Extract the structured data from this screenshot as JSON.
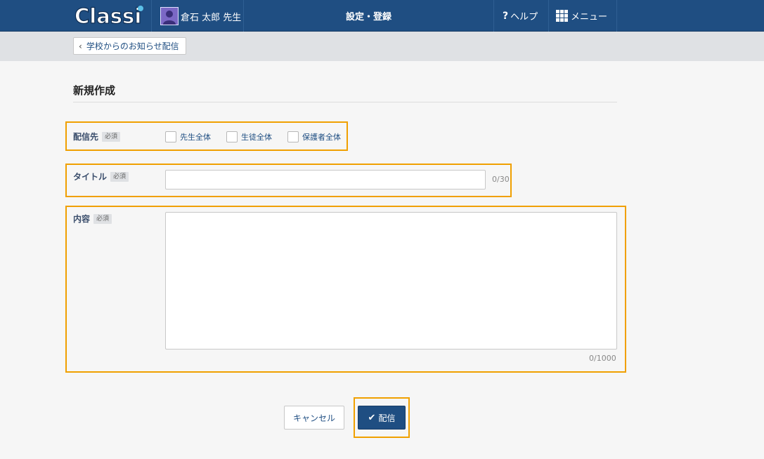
{
  "header": {
    "logo_text": "Classi",
    "user_name": "倉石 太郎 先生",
    "title": "設定・登録",
    "help_label": "ヘルプ",
    "menu_label": "メニュー",
    "brand_color": "#1f4e82",
    "icons": {
      "help": "question-icon",
      "menu": "grid-icon",
      "avatar": "person-icon"
    }
  },
  "subbar": {
    "back_label": "学校からのお知らせ配信"
  },
  "form": {
    "page_title": "新規作成",
    "required_badge": "必須",
    "recipients": {
      "label": "配信先",
      "options": [
        {
          "label": "先生全体",
          "checked": false
        },
        {
          "label": "生徒全体",
          "checked": false
        },
        {
          "label": "保護者全体",
          "checked": false
        }
      ]
    },
    "title_field": {
      "label": "タイトル",
      "value": "",
      "counter": "0/30"
    },
    "body_field": {
      "label": "内容",
      "value": "",
      "counter": "0/1000"
    },
    "cancel_label": "キャンセル",
    "submit_label": "配信"
  },
  "highlight_color": "#f0a000"
}
